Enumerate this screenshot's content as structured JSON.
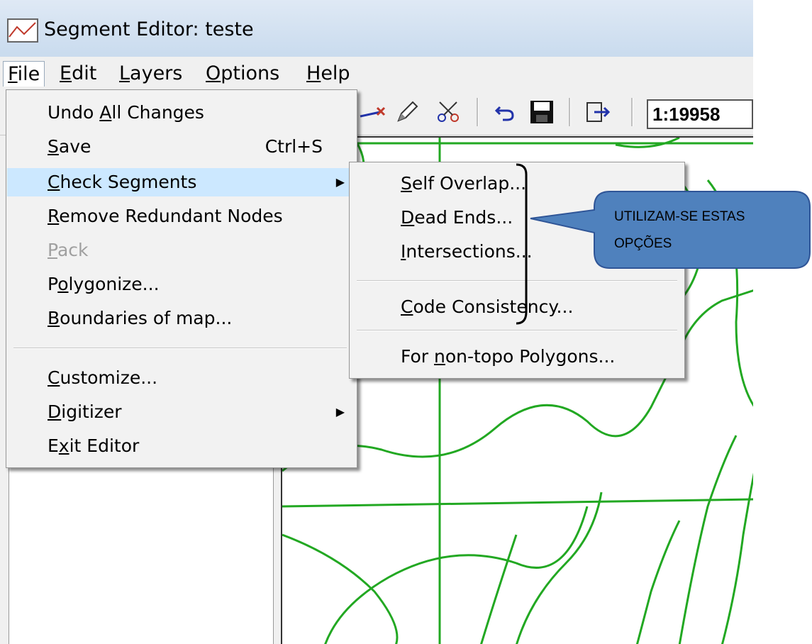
{
  "window": {
    "title": "Segment Editor: teste",
    "icon": "segment-editor-icon"
  },
  "menubar": {
    "items": [
      {
        "label": "File",
        "key": "F",
        "rest": "ile"
      },
      {
        "label": "Edit",
        "key": "E",
        "rest": "dit"
      },
      {
        "label": "Layers",
        "key": "L",
        "rest": "ayers"
      },
      {
        "label": "Options",
        "key": "O",
        "rest": "ptions"
      },
      {
        "label": "Help",
        "key": "H",
        "rest": "elp"
      }
    ]
  },
  "toolbar": {
    "icons": [
      "move-node-icon",
      "pencil-icon",
      "scissors-icon",
      "undo-icon",
      "save-icon",
      "exit-icon"
    ],
    "scale": "1:19958"
  },
  "file_menu": {
    "items": [
      {
        "pre": "Undo ",
        "key": "A",
        "post": "ll Changes"
      },
      {
        "pre": "",
        "key": "S",
        "post": "ave",
        "shortcut": "Ctrl+S"
      },
      {
        "pre": "",
        "key": "C",
        "post": "heck Segments",
        "submenu": true,
        "highlighted": true
      },
      {
        "pre": "",
        "key": "R",
        "post": "emove Redundant Nodes"
      },
      {
        "pre": "",
        "key": "P",
        "post": "ack",
        "disabled": true
      },
      {
        "pre": "P",
        "key": "o",
        "post": "lygonize..."
      },
      {
        "pre": "",
        "key": "B",
        "post": "oundaries of map..."
      },
      {
        "pre": "",
        "key": "C",
        "post": "ustomize..."
      },
      {
        "pre": "",
        "key": "D",
        "post": "igitizer",
        "submenu": true
      },
      {
        "pre": "E",
        "key": "x",
        "post": "it Editor"
      }
    ]
  },
  "check_segments_submenu": {
    "items": [
      {
        "pre": "",
        "key": "S",
        "post": "elf Overlap..."
      },
      {
        "pre": "",
        "key": "D",
        "post": "ead Ends..."
      },
      {
        "pre": "",
        "key": "I",
        "post": "ntersections..."
      },
      {
        "pre": "",
        "key": "C",
        "post": "ode Consistency..."
      },
      {
        "pre": "For ",
        "key": "n",
        "post": "on-topo Polygons..."
      }
    ]
  },
  "callout": {
    "line1": "UTILIZAM-SE   ESTAS",
    "line2": "OPÇÕES"
  },
  "colors": {
    "map_line": "#22a822",
    "menu_highlight": "#cce8ff",
    "callout_fill": "#4f81bd"
  }
}
